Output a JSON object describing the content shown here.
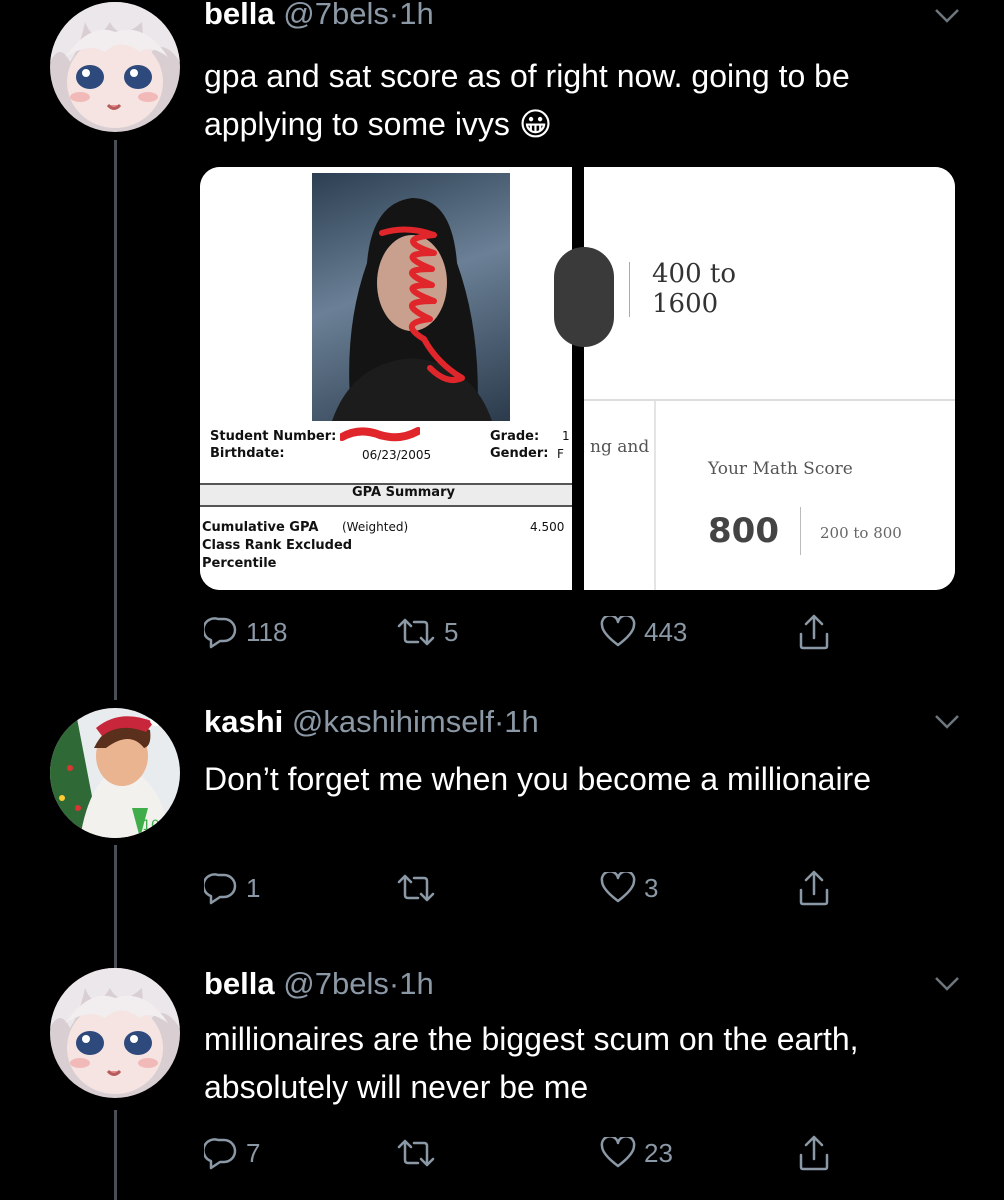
{
  "tweets": [
    {
      "name": "bella",
      "handle": "@7bels",
      "time": "1h",
      "text": "gpa and sat score as of right now. going to be applying to some ivys 😀",
      "replies": "118",
      "retweets": "5",
      "likes": "443"
    },
    {
      "name": "kashi",
      "handle": "@kashihimself",
      "time": "1h",
      "text": "Don’t forget me when you become a millionaire",
      "replies": "1",
      "retweets": "",
      "likes": "3"
    },
    {
      "name": "bella",
      "handle": "@7bels",
      "time": "1h",
      "text": "millionaires are the biggest scum on the earth, absolutely will never be me",
      "replies": "7",
      "retweets": "",
      "likes": "23"
    }
  ],
  "media": {
    "transcript": {
      "student_number_label": "Student Number:",
      "birthdate_label": "Birthdate:",
      "birthdate_value": "06/23/2005",
      "grade_label": "Grade:",
      "grade_value": "1",
      "gender_label": "Gender:",
      "gender_value": "F",
      "section_title": "GPA Summary",
      "gpa_label": "Cumulative GPA",
      "gpa_qualifier": "(Weighted)",
      "gpa_value": "4.500",
      "class_rank_label": "Class Rank Excluded",
      "percentile_label": "Percentile"
    },
    "sat": {
      "total_range": "400 to",
      "total_range_2": "1600",
      "cut_text": "ng and",
      "math_label": "Your Math Score",
      "math_score": "800",
      "math_range": "200 to 800"
    }
  },
  "colors": {
    "background": "#000000",
    "secondary_text": "#8b98a5",
    "scribble": "#e0262a"
  },
  "icons": [
    "reply-icon",
    "retweet-icon",
    "like-icon",
    "share-icon",
    "chevron-down-icon"
  ]
}
